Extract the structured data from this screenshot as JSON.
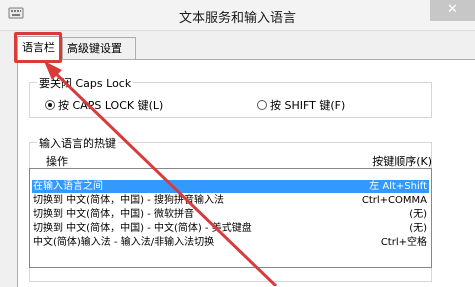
{
  "window": {
    "title": "文本服务和输入语言",
    "close_glyph": "✕",
    "app_icon": "keyboard-icon"
  },
  "tabs": [
    {
      "label": "语言栏",
      "active": true
    },
    {
      "label": "高级键设置",
      "active": false
    }
  ],
  "capslock_group": {
    "title": "要关闭 Caps Lock",
    "options": [
      {
        "label": "按 CAPS LOCK 键(L)",
        "selected": true
      },
      {
        "label": "按 SHIFT 键(F)",
        "selected": false
      }
    ]
  },
  "hotkey_group": {
    "title": "输入语言的热键",
    "col_action": "操作",
    "col_keys": "按键顺序(K)",
    "rows": [
      {
        "action": "在输入语言之间",
        "keys": "左 Alt+Shift",
        "selected": true
      },
      {
        "action": "切换到 中文(简体，中国) - 搜狗拼音输入法",
        "keys": "Ctrl+COMMA",
        "selected": false
      },
      {
        "action": "切换到 中文(简体，中国) - 微软拼音",
        "keys": "(无)",
        "selected": false
      },
      {
        "action": "切换到 中文(简体，中国) - 中文(简体) - 美式键盘",
        "keys": "(无)",
        "selected": false
      },
      {
        "action": "中文(简体)输入法 - 输入法/非输入法切换",
        "keys": "Ctrl+空格",
        "selected": false
      }
    ]
  },
  "annotation": {
    "highlight_color": "#d93b3b"
  }
}
